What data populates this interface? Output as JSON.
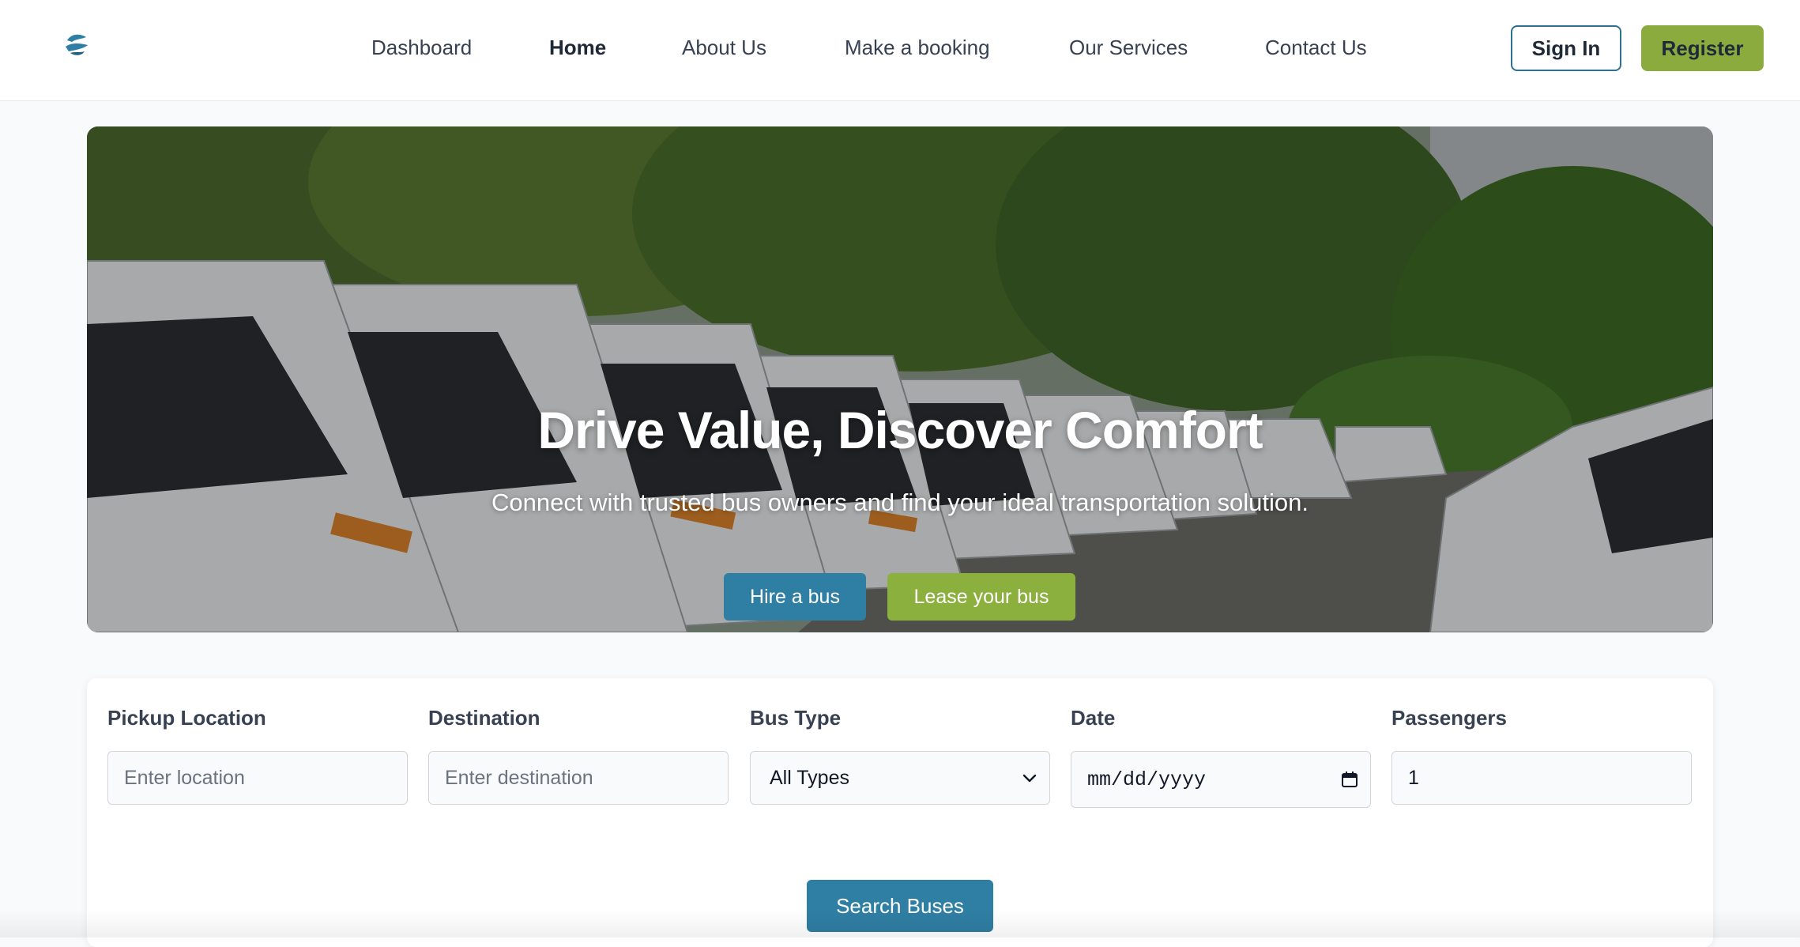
{
  "brand": {
    "logo_icon": "bus-logo-icon",
    "accent": "#2f7ea3",
    "green": "#8bab3f"
  },
  "nav": {
    "items": [
      {
        "label": "Dashboard",
        "active": false
      },
      {
        "label": "Home",
        "active": true
      },
      {
        "label": "About Us",
        "active": false
      },
      {
        "label": "Make a booking",
        "active": false
      },
      {
        "label": "Our Services",
        "active": false
      },
      {
        "label": "Contact Us",
        "active": false
      }
    ],
    "signin_label": "Sign In",
    "register_label": "Register"
  },
  "hero": {
    "title": "Drive Value, Discover Comfort",
    "subtitle": "Connect with trusted bus owners and find your ideal transportation solution.",
    "hire_label": "Hire a bus",
    "lease_label": "Lease your bus"
  },
  "search": {
    "pickup_label": "Pickup Location",
    "pickup_placeholder": "Enter location",
    "destination_label": "Destination",
    "destination_placeholder": "Enter destination",
    "bus_type_label": "Bus Type",
    "bus_type_value": "All Types",
    "date_label": "Date",
    "date_placeholder": "mm/dd/yyyy",
    "passengers_label": "Passengers",
    "passengers_value": "1",
    "submit_label": "Search Buses"
  }
}
